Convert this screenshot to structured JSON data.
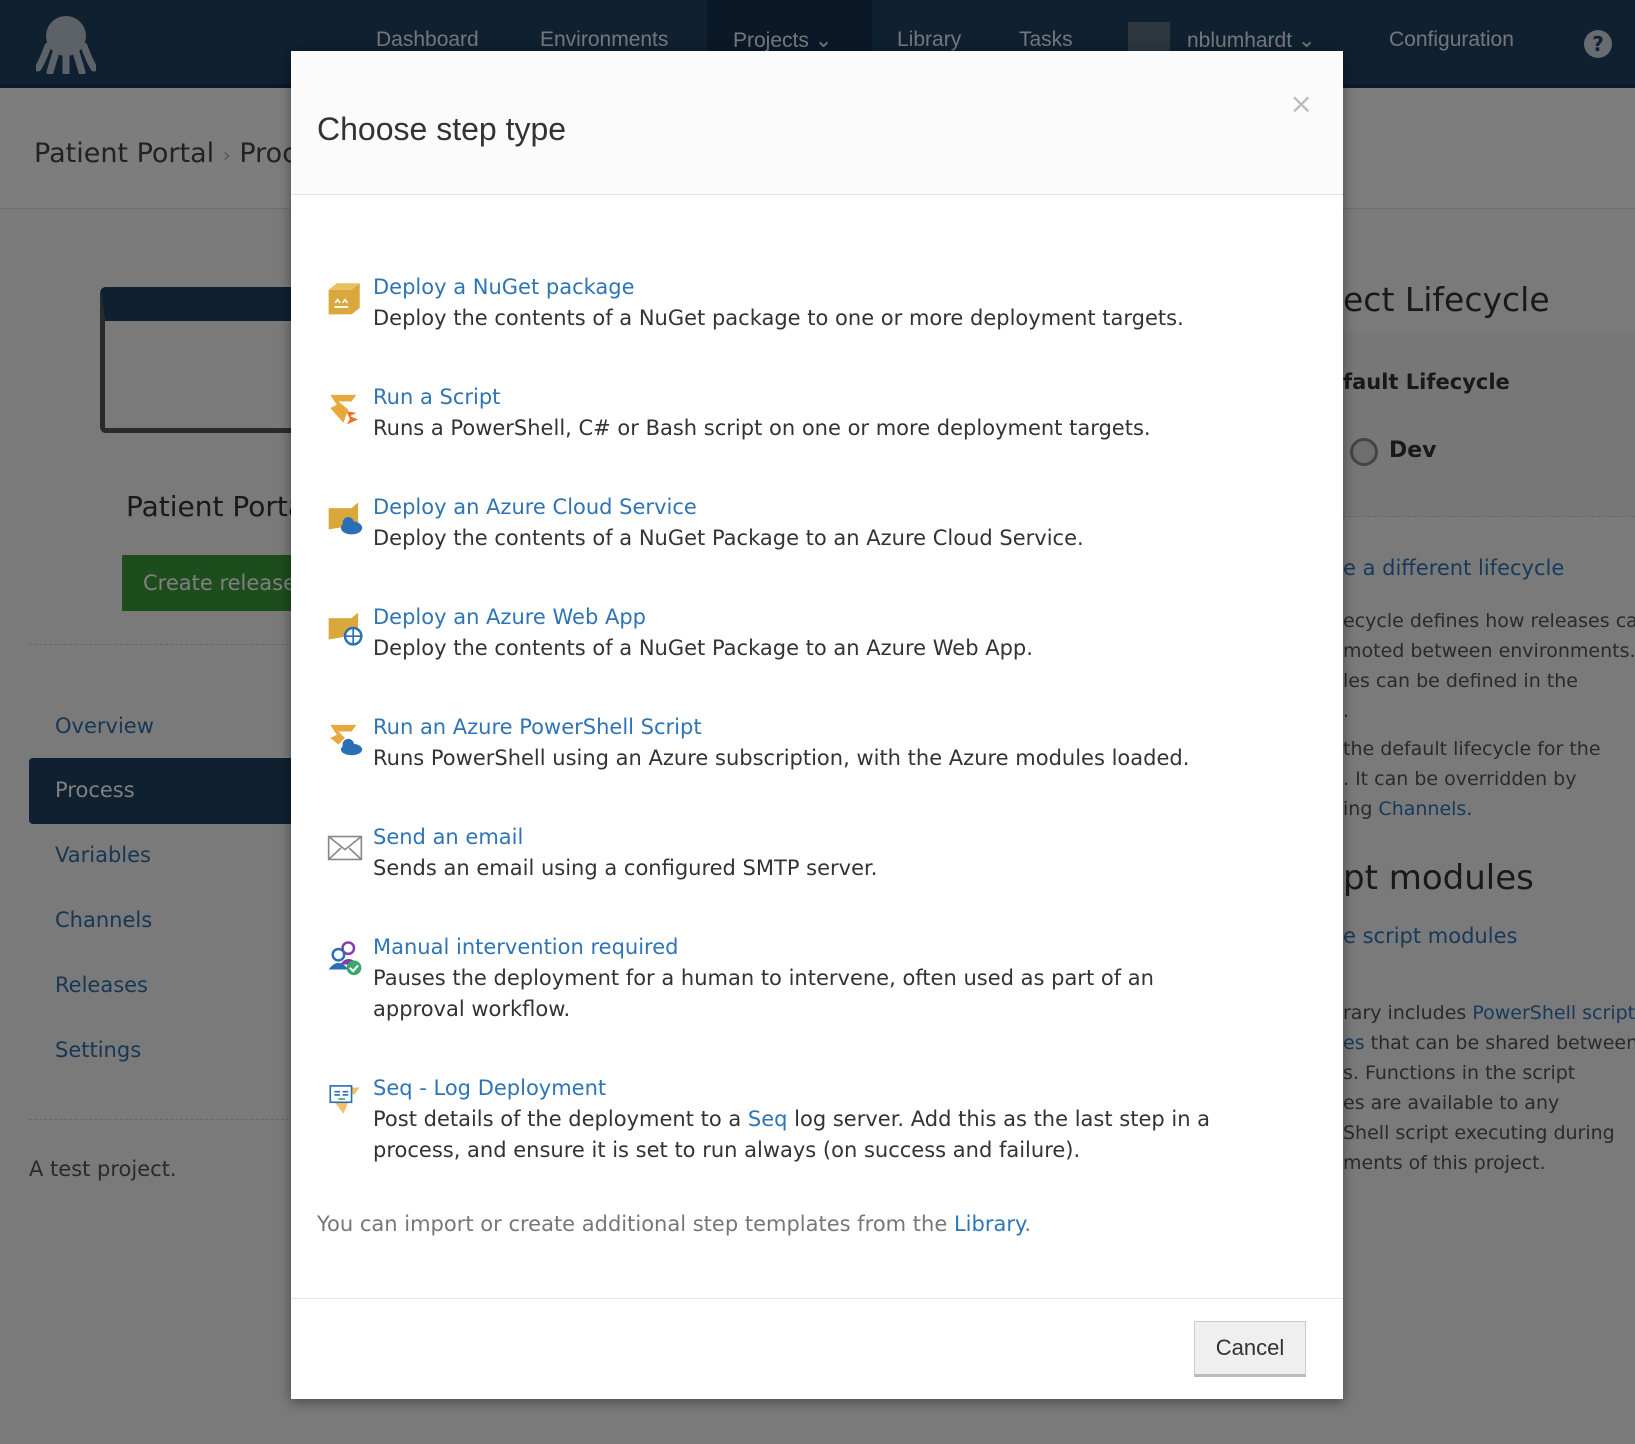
{
  "nav": {
    "items": [
      "Dashboard",
      "Environments",
      "Projects",
      "Library",
      "Tasks"
    ],
    "user": "nblumhardt",
    "configuration": "Configuration"
  },
  "breadcrumb": [
    "Patient Portal",
    "Proc"
  ],
  "project": {
    "name": "Patient Porta",
    "create_release": "Create release",
    "description": "A test project."
  },
  "sidebar": [
    "Overview",
    "Process",
    "Variables",
    "Channels",
    "Releases",
    "Settings"
  ],
  "right": {
    "lifecycle_heading": "ect Lifecycle",
    "lifecycle_name": "fault Lifecycle",
    "env": "Dev",
    "change_link": "e a different lifecycle",
    "p1": [
      "ecycle defines how releases can",
      "moted between environments.",
      "les can be defined in the",
      "."
    ],
    "p2a": "the default lifecycle for the",
    "p2b": ". It can be overridden by",
    "p2c": "ing ",
    "channels": "Channels",
    "p2d": ".",
    "modules_heading": "pt modules",
    "modules_link": "e script modules",
    "p3a": "rary includes ",
    "p3link1": "PowerShell script",
    "p3link2": "es",
    "p3b": " that can be shared between",
    "p3c": [
      "s. Functions in the script",
      "es are available to any",
      "Shell script executing during",
      "ments of this project."
    ]
  },
  "modal": {
    "title": "Choose step type",
    "close": "×",
    "steps": [
      {
        "icon": "nuget-package-icon",
        "title": "Deploy a NuGet package",
        "desc": "Deploy the contents of a NuGet package to one or more deployment targets."
      },
      {
        "icon": "script-icon",
        "title": "Run a Script",
        "desc": "Runs a PowerShell, C# or Bash script on one or more deployment targets."
      },
      {
        "icon": "azure-cloud-service-icon",
        "title": "Deploy an Azure Cloud Service",
        "desc": "Deploy the contents of a NuGet Package to an Azure Cloud Service."
      },
      {
        "icon": "azure-web-app-icon",
        "title": "Deploy an Azure Web App",
        "desc": "Deploy the contents of a NuGet Package to an Azure Web App."
      },
      {
        "icon": "azure-powershell-icon",
        "title": "Run an Azure PowerShell Script",
        "desc": "Runs PowerShell using an Azure subscription, with the Azure modules loaded."
      },
      {
        "icon": "email-icon",
        "title": "Send an email",
        "desc": "Sends an email using a configured SMTP server."
      },
      {
        "icon": "manual-intervention-icon",
        "title": "Manual intervention required",
        "desc": "Pauses the deployment for a human to intervene, often used as part of an approval workflow."
      }
    ],
    "seq": {
      "icon": "seq-icon",
      "title": "Seq - Log Deployment",
      "desc_a": "Post details of the deployment to a ",
      "desc_link": "Seq",
      "desc_b": " log server. Add this as the last step in a process, and ensure it is set to run always (on success and failure)."
    },
    "footnote_a": "You can import or create additional step templates from the ",
    "footnote_link": "Library",
    "footnote_b": ".",
    "cancel": "Cancel"
  },
  "colors": {
    "header": "#1e4060",
    "link": "#2f74b5",
    "create_release": "#3a9a3a"
  }
}
